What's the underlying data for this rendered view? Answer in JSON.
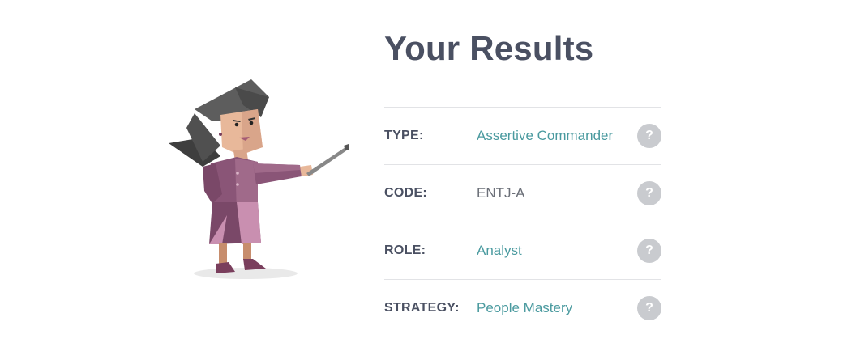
{
  "title": "Your Results",
  "rows": [
    {
      "label": "TYPE:",
      "value": "Assertive Commander",
      "help": "?"
    },
    {
      "label": "CODE:",
      "value": "ENTJ-A",
      "help": "?"
    },
    {
      "label": "ROLE:",
      "value": "Analyst",
      "help": "?"
    },
    {
      "label": "STRATEGY:",
      "value": "People Mastery",
      "help": "?"
    }
  ],
  "colors": {
    "heading": "#4a5062",
    "link_value": "#4a9a9f",
    "plain_value": "#6b6f78",
    "divider": "#e2e3e6",
    "help_badge": "#c9cbcf"
  },
  "icons": {
    "illustration": "commander-character-illustration",
    "help": "question-mark-icon"
  }
}
